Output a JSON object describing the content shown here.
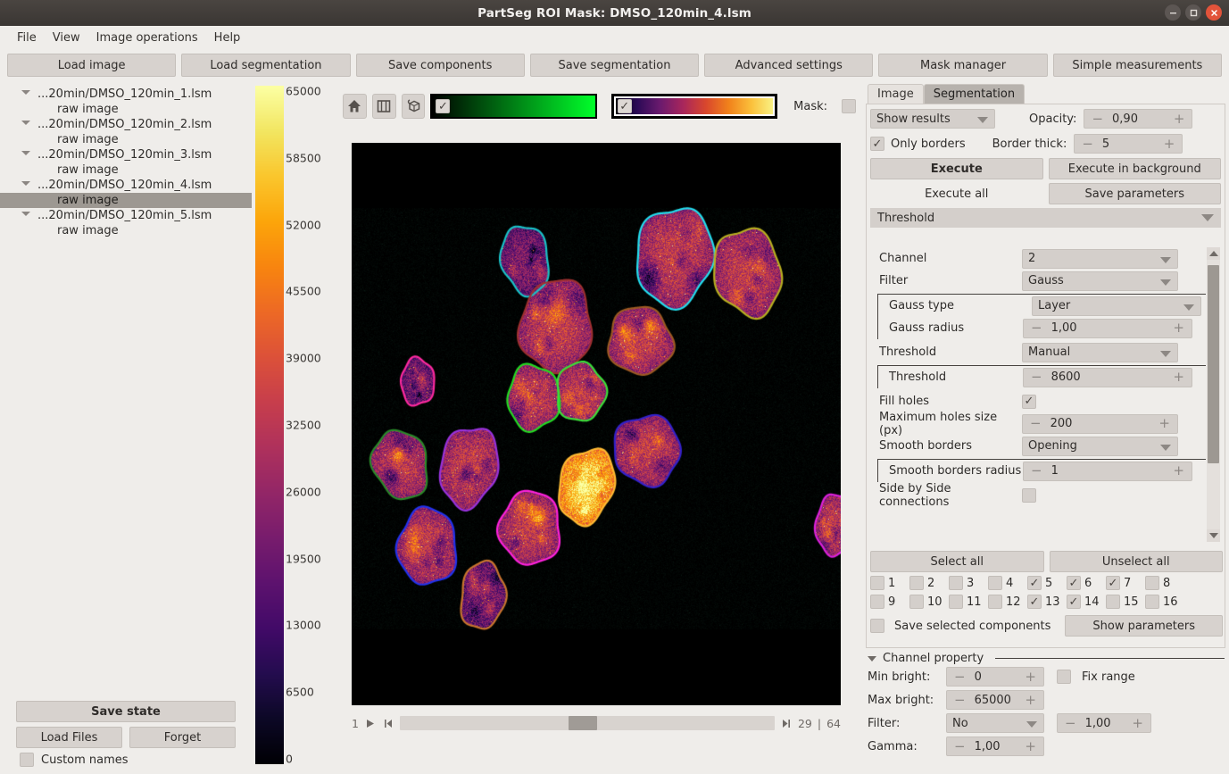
{
  "window": {
    "title": "PartSeg ROI Mask: DMSO_120min_4.lsm",
    "minimize": "–",
    "maximize": "□",
    "close": "✕"
  },
  "menubar": {
    "items": [
      "File",
      "View",
      "Image operations",
      "Help"
    ]
  },
  "toolbar": {
    "buttons": [
      "Load image",
      "Load segmentation",
      "Save components",
      "Save segmentation",
      "Advanced settings",
      "Mask manager",
      "Simple measurements"
    ]
  },
  "filetree": {
    "groups": [
      {
        "file": "...20min/DMSO_120min_1.lsm",
        "child": "raw image",
        "selected": false
      },
      {
        "file": "...20min/DMSO_120min_2.lsm",
        "child": "raw image",
        "selected": false
      },
      {
        "file": "...20min/DMSO_120min_3.lsm",
        "child": "raw image",
        "selected": false
      },
      {
        "file": "...20min/DMSO_120min_4.lsm",
        "child": "raw image",
        "selected": true
      },
      {
        "file": "...20min/DMSO_120min_5.lsm",
        "child": "raw image",
        "selected": false
      }
    ]
  },
  "left_bottom": {
    "save_state": "Save state",
    "load_files": "Load Files",
    "forget": "Forget",
    "custom_names": "Custom names",
    "custom_names_checked": false
  },
  "colorbar": {
    "ticks": [
      "65000",
      "58500",
      "52000",
      "45500",
      "39000",
      "32500",
      "26000",
      "19500",
      "13000",
      "6500",
      "0"
    ],
    "min": 0,
    "max": 65000,
    "colormap": "inferno"
  },
  "image_toolbar": {
    "home_icon": "home-icon",
    "roll_icon": "roll-dims-icon",
    "ndisplay_icon": "ndisplay-icon",
    "channel1": {
      "checked": true,
      "colormap": "green"
    },
    "channel2": {
      "checked": true,
      "colormap": "inferno",
      "selected": true
    },
    "mask_label": "Mask:",
    "mask_checked": false
  },
  "image_nav": {
    "current_axis": "1",
    "frame": "29",
    "separator": "|",
    "total": "64",
    "play_icon": "play-icon",
    "first_icon": "step-first-icon",
    "last_icon": "step-last-icon"
  },
  "right_panel": {
    "tabs": [
      {
        "label": "Image",
        "active": false
      },
      {
        "label": "Segmentation",
        "active": true
      }
    ],
    "show_results": "Show results",
    "opacity_label": "Opacity:",
    "opacity_value": "0,90",
    "only_borders_label": "Only borders",
    "only_borders_checked": true,
    "border_thick_label": "Border thick:",
    "border_thick_value": "5",
    "execute": "Execute",
    "execute_background": "Execute in background",
    "execute_all": "Execute all",
    "save_parameters": "Save parameters",
    "algorithm_section": "Threshold",
    "params": [
      {
        "kind": "combo",
        "label": "Channel",
        "value": "2",
        "group": false
      },
      {
        "kind": "combo",
        "label": "Filter",
        "value": "Gauss",
        "group": false
      },
      {
        "kind": "combo",
        "label": "Gauss type",
        "value": "Layer",
        "group": true
      },
      {
        "kind": "spin",
        "label": "Gauss radius",
        "value": "1,00",
        "group": true
      },
      {
        "kind": "combo",
        "label": "Threshold",
        "value": "Manual",
        "group": false
      },
      {
        "kind": "spin",
        "label": "Threshold",
        "value": "8600",
        "group": true
      },
      {
        "kind": "check",
        "label": "Fill holes",
        "value": true,
        "group": false
      },
      {
        "kind": "spin",
        "label": "Maximum holes size (px)",
        "value": "200",
        "group": false
      },
      {
        "kind": "combo",
        "label": "Smooth borders",
        "value": "Opening",
        "group": false
      },
      {
        "kind": "spin",
        "label": "Smooth borders radius",
        "value": "1",
        "group": true
      },
      {
        "kind": "check",
        "label": "Side by Side connections",
        "value": false,
        "group": false
      }
    ],
    "select_all": "Select all",
    "unselect_all": "Unselect all",
    "components": [
      {
        "n": "1",
        "checked": false
      },
      {
        "n": "2",
        "checked": false
      },
      {
        "n": "3",
        "checked": false
      },
      {
        "n": "4",
        "checked": false
      },
      {
        "n": "5",
        "checked": true
      },
      {
        "n": "6",
        "checked": true
      },
      {
        "n": "7",
        "checked": true
      },
      {
        "n": "8",
        "checked": false
      },
      {
        "n": "9",
        "checked": false
      },
      {
        "n": "10",
        "checked": false
      },
      {
        "n": "11",
        "checked": false
      },
      {
        "n": "12",
        "checked": false
      },
      {
        "n": "13",
        "checked": true
      },
      {
        "n": "14",
        "checked": true
      },
      {
        "n": "15",
        "checked": false
      },
      {
        "n": "16",
        "checked": false
      }
    ],
    "save_selected_components": "Save selected components",
    "save_selected_checked": false,
    "show_parameters": "Show parameters"
  },
  "channel_property": {
    "title": "Channel property",
    "min_bright_label": "Min bright:",
    "min_bright_value": "0",
    "fix_range_label": "Fix range",
    "fix_range_checked": false,
    "max_bright_label": "Max bright:",
    "max_bright_value": "65000",
    "filter_label": "Filter:",
    "filter_value": "No",
    "filter_radius": "1,00",
    "gamma_label": "Gamma:",
    "gamma_value": "1,00"
  },
  "microscopy": {
    "description": "Confocal fluorescence image of cell nuclei with ROI outlines",
    "nuclei": [
      {
        "cx": 0.355,
        "cy": 0.208,
        "rx": 0.048,
        "ry": 0.062,
        "outline": "#19c3c8",
        "fill": "dim",
        "rot": -10
      },
      {
        "cx": 0.66,
        "cy": 0.202,
        "rx": 0.078,
        "ry": 0.088,
        "outline": "#22e0f0",
        "fill": "bright",
        "rot": 8
      },
      {
        "cx": 0.81,
        "cy": 0.23,
        "rx": 0.068,
        "ry": 0.078,
        "outline": "#b8b020",
        "fill": "bright",
        "rot": -12
      },
      {
        "cx": 0.418,
        "cy": 0.325,
        "rx": 0.073,
        "ry": 0.082,
        "outline": "#9e3030",
        "fill": "bright",
        "rot": 5
      },
      {
        "cx": 0.59,
        "cy": 0.352,
        "rx": 0.065,
        "ry": 0.06,
        "outline": "#9c5a22",
        "fill": "bright",
        "rot": -14
      },
      {
        "cx": 0.135,
        "cy": 0.425,
        "rx": 0.034,
        "ry": 0.042,
        "outline": "#ff2aa0",
        "fill": "dim",
        "rot": 0
      },
      {
        "cx": 0.372,
        "cy": 0.453,
        "rx": 0.053,
        "ry": 0.058,
        "outline": "#22dd22",
        "fill": "bright",
        "rot": 0
      },
      {
        "cx": 0.468,
        "cy": 0.443,
        "rx": 0.05,
        "ry": 0.052,
        "outline": "#3ae03a",
        "fill": "bright",
        "rot": 0
      },
      {
        "cx": 0.1,
        "cy": 0.572,
        "rx": 0.055,
        "ry": 0.062,
        "outline": "#2a8a2a",
        "fill": "bright",
        "rot": -18
      },
      {
        "cx": 0.24,
        "cy": 0.576,
        "rx": 0.058,
        "ry": 0.072,
        "outline": "#9933dd",
        "fill": "bright",
        "rot": 12
      },
      {
        "cx": 0.604,
        "cy": 0.546,
        "rx": 0.067,
        "ry": 0.062,
        "outline": "#3322cc",
        "fill": "bright",
        "rot": -16
      },
      {
        "cx": 0.48,
        "cy": 0.61,
        "rx": 0.055,
        "ry": 0.068,
        "outline": "#ffbb33",
        "fill": "very-bright",
        "rot": 16
      },
      {
        "cx": 0.155,
        "cy": 0.718,
        "rx": 0.06,
        "ry": 0.068,
        "outline": "#2233ee",
        "fill": "bright",
        "rot": 0
      },
      {
        "cx": 0.365,
        "cy": 0.685,
        "rx": 0.062,
        "ry": 0.065,
        "outline": "#ff22dd",
        "fill": "bright",
        "rot": 0
      },
      {
        "cx": 0.268,
        "cy": 0.805,
        "rx": 0.045,
        "ry": 0.06,
        "outline": "#c9762e",
        "fill": "dim",
        "rot": 6
      },
      {
        "cx": 0.985,
        "cy": 0.68,
        "rx": 0.035,
        "ry": 0.055,
        "outline": "#dd22dd",
        "fill": "bright",
        "rot": 0
      }
    ]
  }
}
